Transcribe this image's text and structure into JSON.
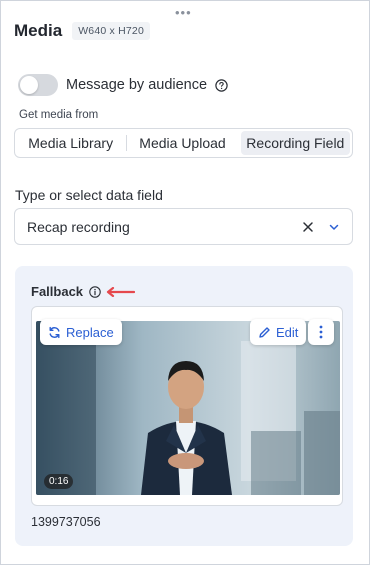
{
  "header": {
    "title": "Media",
    "dimensions": "W640 x H720"
  },
  "audience_toggle": {
    "label": "Message by audience",
    "enabled": false
  },
  "media_source": {
    "label": "Get media from",
    "options": [
      "Media Library",
      "Media Upload",
      "Recording Field"
    ],
    "selected": "Recording Field"
  },
  "data_field": {
    "label": "Type or select data field",
    "value": "Recap recording"
  },
  "fallback": {
    "title": "Fallback",
    "replace_label": "Replace",
    "edit_label": "Edit",
    "duration": "0:16",
    "media_id": "1399737056"
  },
  "colors": {
    "accent": "#2b5fd3",
    "card_bg": "#eef2fa",
    "arrow": "#e5484d"
  },
  "icons": {
    "help": "help-circle-icon",
    "info": "info-icon",
    "clear": "close-icon",
    "chevron": "chevron-down-icon",
    "replace": "refresh-icon",
    "edit": "pencil-icon",
    "more": "more-vertical-icon",
    "drag": "drag-handle-icon"
  }
}
